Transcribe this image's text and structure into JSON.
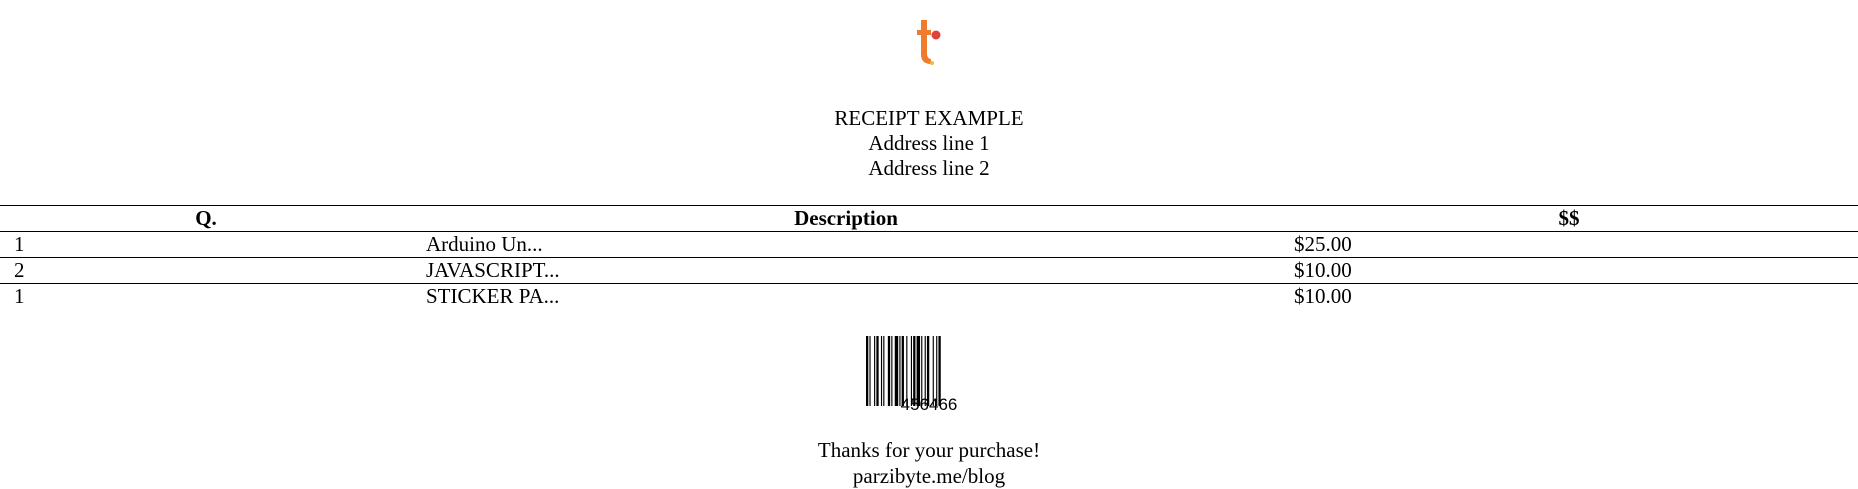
{
  "header": {
    "title": "RECEIPT EXAMPLE",
    "address_line_1": "Address line 1",
    "address_line_2": "Address line 2"
  },
  "table": {
    "columns": [
      "Q.",
      "Description",
      "$$"
    ],
    "rows": [
      {
        "q": "1",
        "description": "Arduino Un...",
        "amount": "$25.00"
      },
      {
        "q": "2",
        "description": "JAVASCRIPT...",
        "amount": "$10.00"
      },
      {
        "q": "1",
        "description": "STICKER PA...",
        "amount": "$10.00"
      }
    ]
  },
  "barcode": {
    "number": "456466"
  },
  "footer": {
    "thanks": "Thanks for your purchase!",
    "website": "parzibyte.me/blog"
  },
  "colors": {
    "logo_orange": "#f07a2e",
    "logo_red": "#e0413c",
    "logo_yellow": "#f6b830"
  },
  "icons": {
    "logo": "brand-logo-icon"
  }
}
